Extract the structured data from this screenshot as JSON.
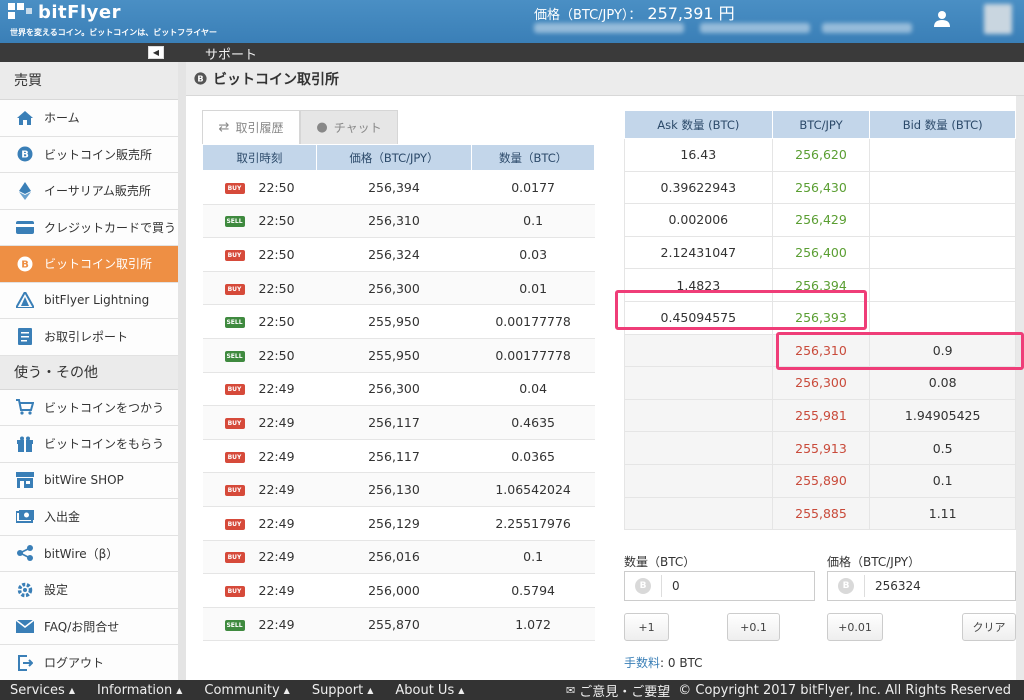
{
  "header": {
    "logo_text": "bitFlyer",
    "tagline": "世界を変えるコイン。ビットコインは、ビットフライヤー",
    "price_label": "価格（BTC/JPY）：",
    "price_value": "257,391 円"
  },
  "subbar": {
    "label": "サポート"
  },
  "sidebar": {
    "section1": "売買",
    "items1": [
      {
        "label": "ホーム",
        "icon": "home-icon"
      },
      {
        "label": "ビットコイン販売所",
        "icon": "bitcoin-icon"
      },
      {
        "label": "イーサリアム販売所",
        "icon": "ethereum-icon"
      },
      {
        "label": "クレジットカードで買う",
        "icon": "credit-card-icon"
      },
      {
        "label": "ビットコイン取引所",
        "icon": "bitcoin-icon"
      },
      {
        "label": "bitFlyer Lightning",
        "icon": "lightning-icon"
      },
      {
        "label": "お取引レポート",
        "icon": "report-icon"
      }
    ],
    "section2": "使う・その他",
    "items2": [
      {
        "label": "ビットコインをつかう",
        "icon": "cart-icon"
      },
      {
        "label": "ビットコインをもらう",
        "icon": "gift-icon"
      },
      {
        "label": "bitWire SHOP",
        "icon": "shop-icon"
      },
      {
        "label": "入出金",
        "icon": "money-icon"
      },
      {
        "label": "bitWire（β）",
        "icon": "share-icon"
      },
      {
        "label": "設定",
        "icon": "gear-icon"
      },
      {
        "label": "FAQ/お問合せ",
        "icon": "mail-icon"
      },
      {
        "label": "ログアウト",
        "icon": "logout-icon"
      }
    ]
  },
  "page": {
    "title": "ビットコイン取引所"
  },
  "tabs": {
    "history": "取引履歴",
    "chat": "チャット"
  },
  "trades": {
    "headers": [
      "取引時刻",
      "価格（BTC/JPY）",
      "数量（BTC）"
    ],
    "rows": [
      {
        "side": "BUY",
        "time": "22:50",
        "price": "256,394",
        "qty": "0.0177"
      },
      {
        "side": "SELL",
        "time": "22:50",
        "price": "256,310",
        "qty": "0.1"
      },
      {
        "side": "BUY",
        "time": "22:50",
        "price": "256,324",
        "qty": "0.03"
      },
      {
        "side": "BUY",
        "time": "22:50",
        "price": "256,300",
        "qty": "0.01"
      },
      {
        "side": "SELL",
        "time": "22:50",
        "price": "255,950",
        "qty": "0.00177778"
      },
      {
        "side": "SELL",
        "time": "22:50",
        "price": "255,950",
        "qty": "0.00177778"
      },
      {
        "side": "BUY",
        "time": "22:49",
        "price": "256,300",
        "qty": "0.04"
      },
      {
        "side": "BUY",
        "time": "22:49",
        "price": "256,117",
        "qty": "0.4635"
      },
      {
        "side": "BUY",
        "time": "22:49",
        "price": "256,117",
        "qty": "0.0365"
      },
      {
        "side": "BUY",
        "time": "22:49",
        "price": "256,130",
        "qty": "1.06542024"
      },
      {
        "side": "BUY",
        "time": "22:49",
        "price": "256,129",
        "qty": "2.25517976"
      },
      {
        "side": "BUY",
        "time": "22:49",
        "price": "256,016",
        "qty": "0.1"
      },
      {
        "side": "BUY",
        "time": "22:49",
        "price": "256,000",
        "qty": "0.5794"
      },
      {
        "side": "SELL",
        "time": "22:49",
        "price": "255,870",
        "qty": "1.072"
      }
    ]
  },
  "book": {
    "headers": [
      "Ask 数量 (BTC)",
      "BTC/JPY",
      "Bid 数量 (BTC)"
    ],
    "asks": [
      {
        "qty": "16.43",
        "price": "256,620"
      },
      {
        "qty": "0.39622943",
        "price": "256,430"
      },
      {
        "qty": "0.002006",
        "price": "256,429"
      },
      {
        "qty": "2.12431047",
        "price": "256,400"
      },
      {
        "qty": "1.4823",
        "price": "256,394"
      },
      {
        "qty": "0.45094575",
        "price": "256,393"
      }
    ],
    "bids": [
      {
        "price": "256,310",
        "qty": "0.9"
      },
      {
        "price": "256,300",
        "qty": "0.08"
      },
      {
        "price": "255,981",
        "qty": "1.94905425"
      },
      {
        "price": "255,913",
        "qty": "0.5"
      },
      {
        "price": "255,890",
        "qty": "0.1"
      },
      {
        "price": "255,885",
        "qty": "1.11"
      }
    ],
    "ask_color": "#5a9e32",
    "bid_color": "#c94a3a",
    "highlight_color": "#ef3d78"
  },
  "form": {
    "qty_label": "数量（BTC）",
    "qty_value": "0",
    "price_label": "価格（BTC/JPY）",
    "price_value": "256324",
    "btn_plus1": "+1",
    "btn_plus01": "+0.1",
    "btn_plus001": "+0.01",
    "btn_clear": "クリア",
    "fee_label": "手数料",
    "fee_value": ": 0 BTC"
  },
  "footer": {
    "menus": [
      "Services",
      "Information",
      "Community",
      "Support",
      "About Us"
    ],
    "feedback": "ご意見・ご要望",
    "copyright": "© Copyright 2017 bitFlyer, Inc. All Rights Reserved"
  }
}
